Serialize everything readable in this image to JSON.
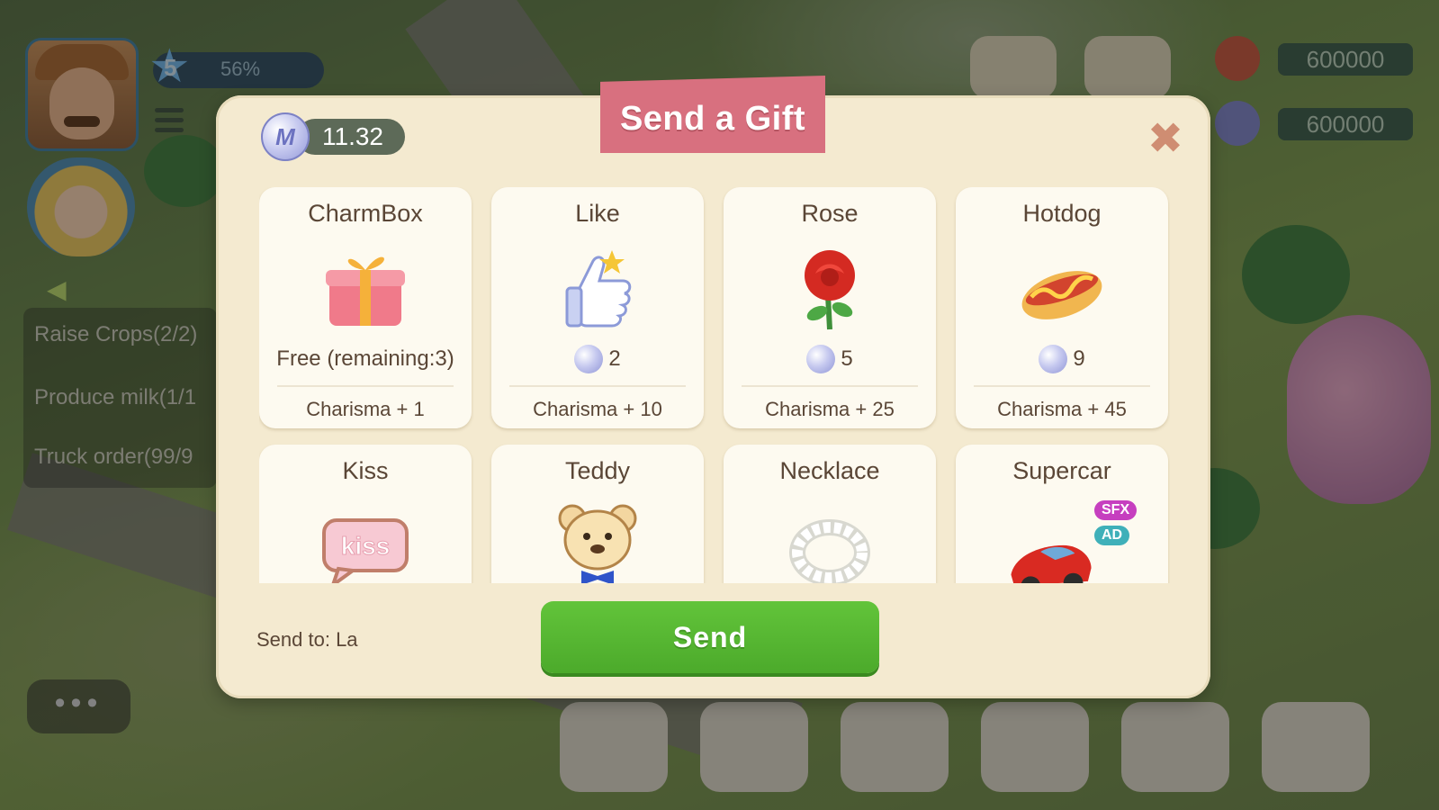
{
  "hud": {
    "level": "5",
    "level_progress": "56%",
    "resources": [
      {
        "icon": "heart-currency-icon",
        "amount": "600000"
      },
      {
        "icon": "m-coin-icon",
        "amount": "600000"
      }
    ],
    "quests": [
      "Raise Crops(2/2)",
      "Produce milk(1/1",
      "Truck order(99/9"
    ]
  },
  "dialog": {
    "title": "Send a Gift",
    "balance": "11.32",
    "coin_letter": "M",
    "close_icon": "close-icon",
    "send_to": "Send to: La",
    "send_label": "Send",
    "gifts": [
      {
        "name": "CharmBox",
        "icon": "gift-box-icon",
        "price": "Free (remaining:3)",
        "free": true,
        "charisma": "Charisma + 1"
      },
      {
        "name": "Like",
        "icon": "thumbs-up-icon",
        "price": "2",
        "free": false,
        "charisma": "Charisma + 10"
      },
      {
        "name": "Rose",
        "icon": "rose-icon",
        "price": "5",
        "free": false,
        "charisma": "Charisma + 25"
      },
      {
        "name": "Hotdog",
        "icon": "hotdog-icon",
        "price": "9",
        "free": false,
        "charisma": "Charisma + 45"
      },
      {
        "name": "Kiss",
        "icon": "kiss-bubble-icon",
        "art_text": "kiss"
      },
      {
        "name": "Teddy",
        "icon": "teddy-bear-icon"
      },
      {
        "name": "Necklace",
        "icon": "pearl-necklace-icon"
      },
      {
        "name": "Supercar",
        "icon": "sports-car-icon",
        "badges": [
          "SFX",
          "AD"
        ]
      }
    ]
  }
}
